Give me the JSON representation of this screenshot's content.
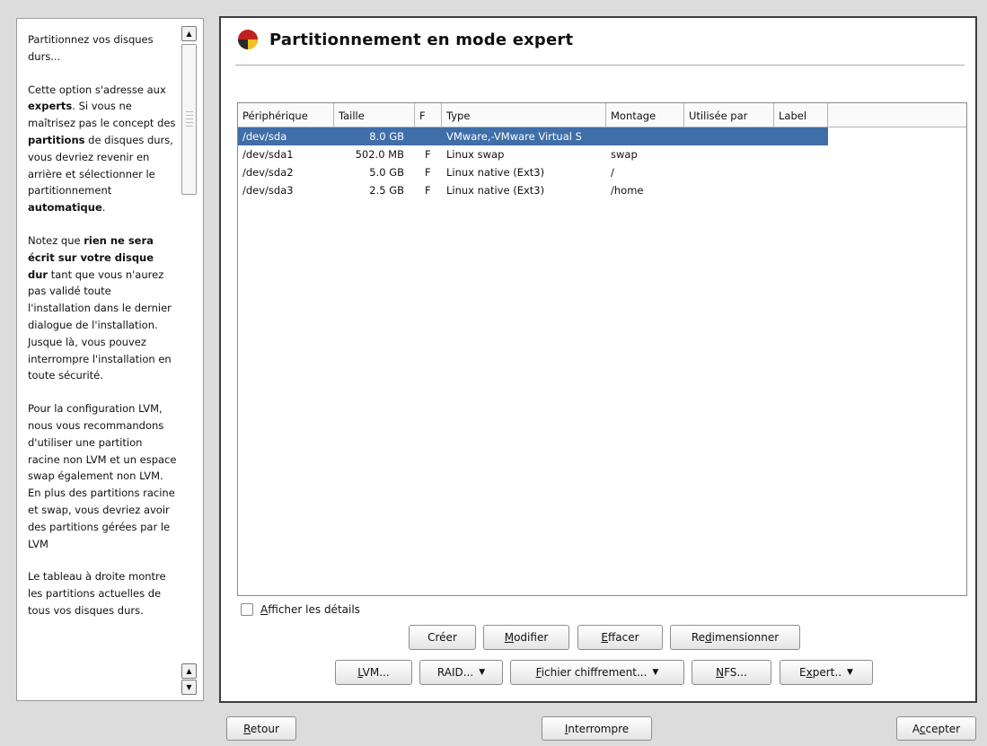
{
  "help": {
    "title": "Partitionnez vos disques durs..."
  },
  "main": {
    "title": "Partitionnement en mode expert"
  },
  "table": {
    "headers": [
      "Périphérique",
      "Taille",
      "F",
      "Type",
      "Montage",
      "Utilisée par",
      "Label"
    ],
    "rows": [
      {
        "device": "/dev/sda",
        "size": "8.0 GB",
        "f": "",
        "type": "VMware,-VMware Virtual S",
        "mount": "",
        "used_by": "",
        "label": ""
      },
      {
        "device": "/dev/sda1",
        "size": "502.0 MB",
        "f": "F",
        "type": "Linux swap",
        "mount": "swap",
        "used_by": "",
        "label": ""
      },
      {
        "device": "/dev/sda2",
        "size": "5.0 GB",
        "f": "F",
        "type": "Linux native (Ext3)",
        "mount": "/",
        "used_by": "",
        "label": ""
      },
      {
        "device": "/dev/sda3",
        "size": "2.5 GB",
        "f": "F",
        "type": "Linux native (Ext3)",
        "mount": "/home",
        "used_by": "",
        "label": ""
      }
    ],
    "selected_row": 0
  },
  "details_checkbox": {
    "label_prefix": "A",
    "label_rest": "fficher les détails",
    "checked": false
  },
  "buttons": {
    "create": "Créer",
    "modify_u": "M",
    "modify_rest": "odifier",
    "delete_u": "E",
    "delete_rest": "ffacer",
    "resize_pre": "Re",
    "resize_u": "d",
    "resize_rest": "imensionner",
    "lvm_u": "L",
    "lvm_rest": "VM...",
    "raid": "RAID...",
    "crypt_u": "F",
    "crypt_rest": "ichier chiffrement...",
    "nfs_u": "N",
    "nfs_rest": "FS...",
    "expert_pre": "E",
    "expert_u": "x",
    "expert_rest": "pert..",
    "back_u": "R",
    "back_rest": "etour",
    "abort_u": "I",
    "abort_rest": "nterrompre",
    "accept_pre": "A",
    "accept_u": "c",
    "accept_rest": "cepter"
  },
  "icons": [
    "app-partition-icon",
    "scroll-up-icon",
    "scroll-down-icon",
    "dropdown-arrow-icon"
  ]
}
